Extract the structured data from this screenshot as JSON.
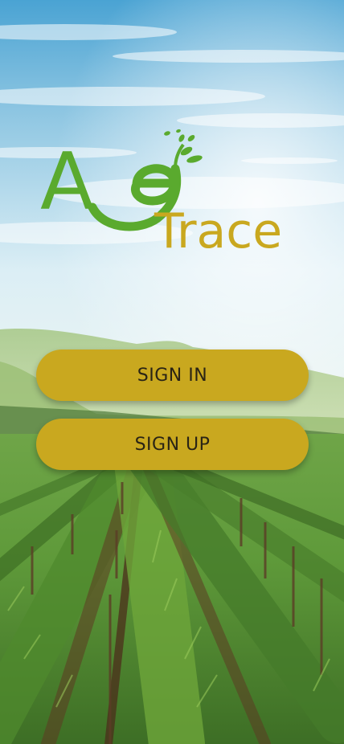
{
  "app": {
    "logo_letters_a": "A",
    "logo_word": "Trace"
  },
  "actions": {
    "sign_in_label": "SIGN IN",
    "sign_up_label": "SIGN UP"
  },
  "colors": {
    "brand_green": "#5aaa2e",
    "brand_gold": "#c9a81f",
    "button_text": "#2a2415"
  },
  "icons": {
    "logo": "agtrace-logo",
    "leaves": "leaf-sprout-icon"
  }
}
